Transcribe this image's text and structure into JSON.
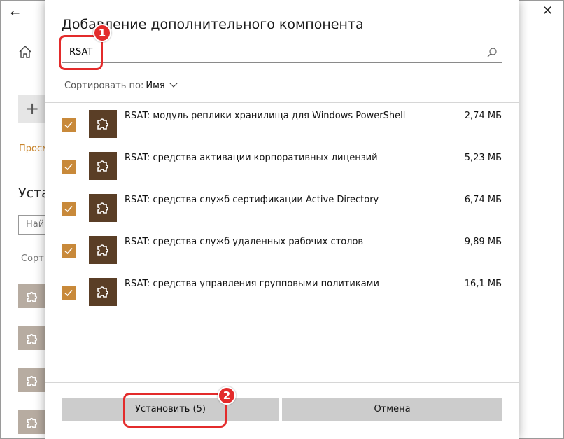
{
  "background": {
    "link_text": "Просм",
    "heading": "Уста",
    "search_placeholder": "Най",
    "sort_text": "Сорт",
    "add_symbol": "+"
  },
  "dialog": {
    "title": "Добавление дополнительного компонента",
    "search": {
      "value": "RSAT",
      "icon": "search-icon"
    },
    "sort": {
      "label": "Сортировать по:",
      "value": "Имя"
    },
    "items": [
      {
        "name": "RSAT: модуль реплики хранилища для Windows PowerShell",
        "size": "2,74 МБ",
        "checked": true
      },
      {
        "name": "RSAT: средства активации корпоративных лицензий",
        "size": "5,23 МБ",
        "checked": true
      },
      {
        "name": "RSAT: средства служб сертификации Active Directory",
        "size": "6,74 МБ",
        "checked": true
      },
      {
        "name": "RSAT: средства служб удаленных рабочих столов",
        "size": "9,89 МБ",
        "checked": true
      },
      {
        "name": "RSAT: средства управления групповыми политиками",
        "size": "16,1 МБ",
        "checked": true
      }
    ],
    "install_label": "Установить (5)",
    "cancel_label": "Отмена"
  },
  "annotations": {
    "badge1": "1",
    "badge2": "2",
    "color": "#e32b2b"
  },
  "colors": {
    "checkbox": "#c8893a",
    "tile": "#5a3e26",
    "button": "#cccccc"
  }
}
